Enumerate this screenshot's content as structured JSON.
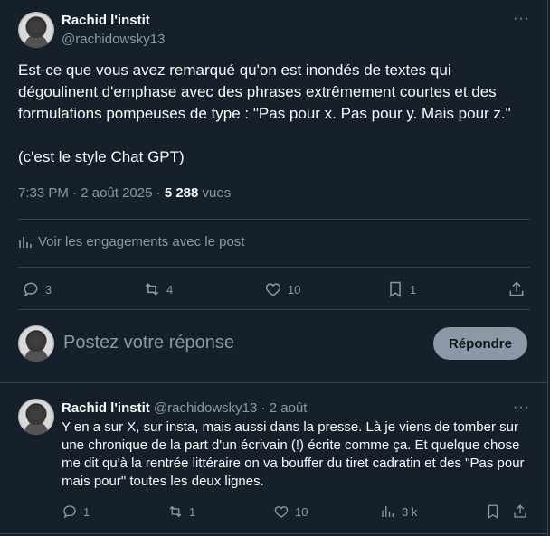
{
  "post": {
    "author_name": "Rachid l'instit",
    "author_handle": "@rachidowsky13",
    "more": "···",
    "text": "Est-ce que vous avez remarqué qu'on est inondés de textes qui dégoulinent d'emphase avec des phrases extrêmement courtes et des formulations pompeuses de type : \"Pas pour x. Pas pour y. Mais pour z.\"\n\n(c'est le style Chat GPT)",
    "time": "7:33 PM",
    "sep": "·",
    "date": "2 août 2025",
    "sep2": "·",
    "views_count": "5 288",
    "views_label": "vues",
    "engagements_label": "Voir les engagements avec le post",
    "actions": {
      "replies": "3",
      "reposts": "4",
      "likes": "10",
      "bookmarks": "1"
    }
  },
  "composer": {
    "placeholder": "Postez votre réponse",
    "button": "Répondre"
  },
  "reply": {
    "author_name": "Rachid l'instit",
    "author_handle": "@rachidowsky13",
    "sep": "·",
    "date": "2 août",
    "more": "···",
    "text": "Y en a sur X, sur insta, mais aussi dans la presse. Là je viens de tomber sur une chronique de la part d'un écrivain (!) écrite comme ça. Et quelque chose me dit qu'à la rentrée littéraire on va bouffer du tiret cadratin et des \"Pas pour mais pour\" toutes les deux lignes.",
    "actions": {
      "replies": "1",
      "reposts": "1",
      "likes": "10",
      "views": "3 k"
    }
  },
  "icons": [
    "more-icon",
    "bar-chart-icon",
    "reply-icon",
    "repost-icon",
    "like-icon",
    "bookmark-icon",
    "share-icon",
    "views-icon"
  ],
  "colors": {
    "background": "#15202b",
    "text": "#f7f9f9",
    "muted": "#8b98a5",
    "border": "#38444d"
  }
}
